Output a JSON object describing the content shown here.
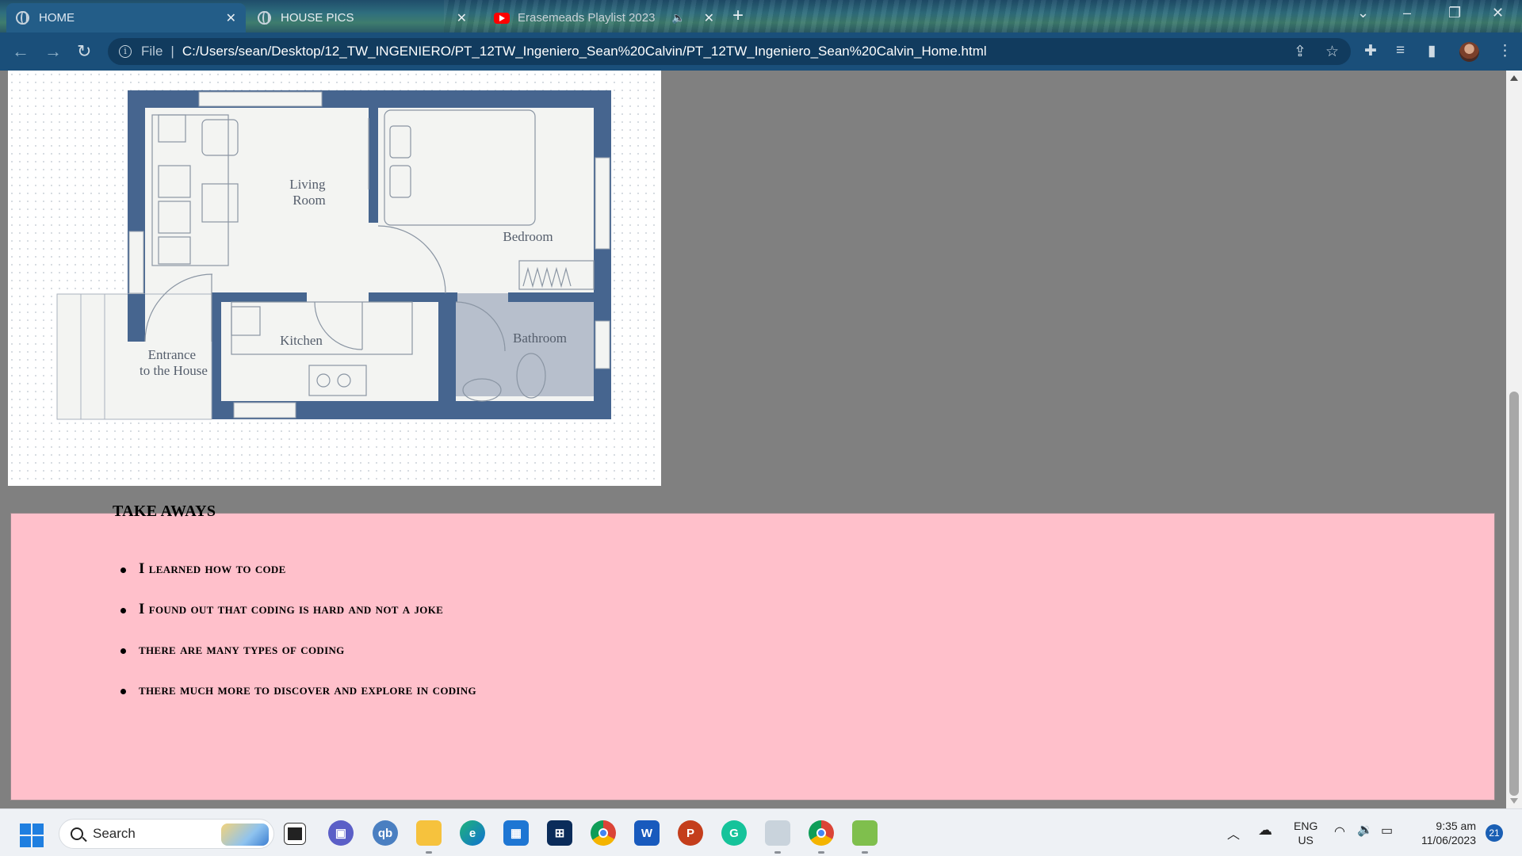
{
  "browser": {
    "tabs": [
      {
        "title": "HOME",
        "active": true
      },
      {
        "title": "HOUSE PICS",
        "active": false
      },
      {
        "title": "Erasemeads Playlist 2023",
        "active": false
      }
    ],
    "address": {
      "scheme_label": "File",
      "url": "C:/Users/sean/Desktop/12_TW_INGENIERO/PT_12TW_Ingeniero_Sean%20Calvin/PT_12TW_Ingeniero_Sean%20Calvin_Home.html"
    }
  },
  "floorplan": {
    "rooms": {
      "living": [
        "Living",
        "Room"
      ],
      "bedroom": "Bedroom",
      "kitchen": "Kitchen",
      "bathroom": "Bathroom",
      "entrance": [
        "Entrance",
        "to the House"
      ]
    },
    "wall_color": "#46658f",
    "floor_color": "#f3f4f2",
    "bathroom_color": "#b7bfcc"
  },
  "takeaways": {
    "heading": "TAKE AWAYS",
    "items": [
      "I learned how to code",
      "I found out that coding is hard and not a joke",
      "there are many types of coding",
      "there much more to discover and explore in coding"
    ],
    "background": "#ffc0cb"
  },
  "taskbar": {
    "search_label": "Search",
    "language": [
      "ENG",
      "US"
    ],
    "time": "9:35 am",
    "date": "11/06/2023",
    "notification_count": "21",
    "apps": [
      "task-view",
      "teams",
      "qb",
      "file-explorer",
      "edge",
      "store",
      "dell",
      "chrome",
      "word",
      "powerpoint",
      "grammarly",
      "notepad",
      "chrome-profile",
      "paint"
    ]
  }
}
